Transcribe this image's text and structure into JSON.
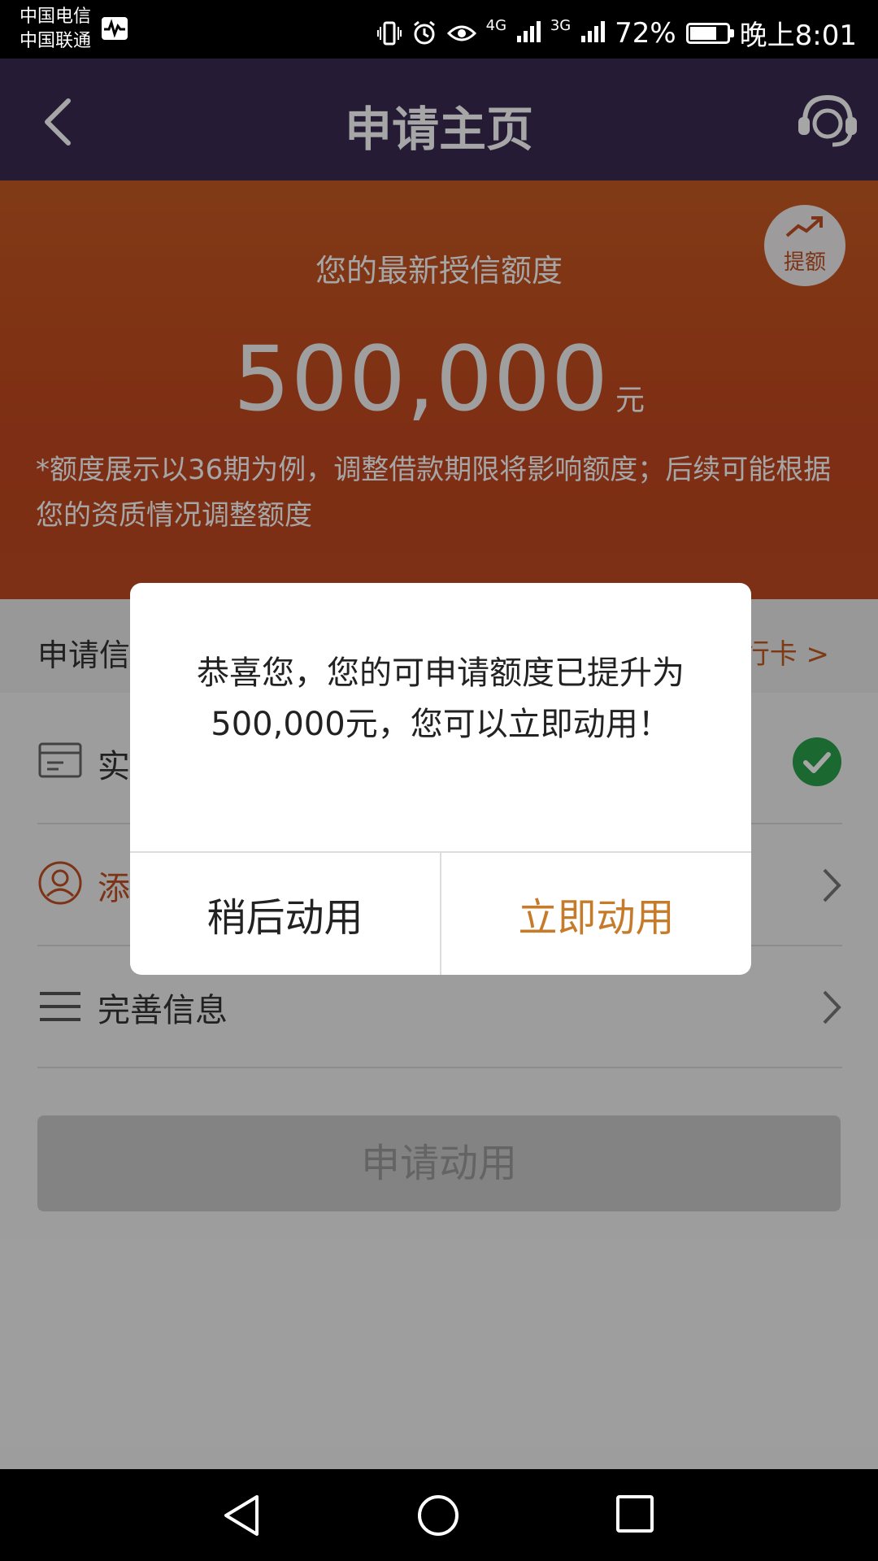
{
  "status_bar": {
    "carrier1": "中国电信",
    "carrier2": "中国联通",
    "net1": "4G",
    "net2": "3G",
    "battery": "72%",
    "battery_level": 0.72,
    "time": "晚上8:01"
  },
  "header": {
    "title": "申请主页"
  },
  "hero": {
    "label": "您的最新授信额度",
    "amount": "500,000",
    "unit": "元",
    "note": "*额度展示以36期为例，调整借款期限将影响额度；后续可能根据您的资质情况调整额度",
    "raise_badge": "提额"
  },
  "bank": {
    "label": "申请信",
    "link": "行卡 >"
  },
  "rows": [
    {
      "label": "实"
    },
    {
      "label": "添"
    },
    {
      "label": "完善信息"
    }
  ],
  "apply_button": "申请动用",
  "dialog": {
    "message": "恭喜您，您的可申请额度已提升为500,000元，您可以立即动用！",
    "later": "稍后动用",
    "now": "立即动用"
  },
  "colors": {
    "header_bg": "#3a2a52",
    "hero_bg": "#c2481f",
    "accent": "#c57b2a",
    "check": "#2aa04a"
  }
}
